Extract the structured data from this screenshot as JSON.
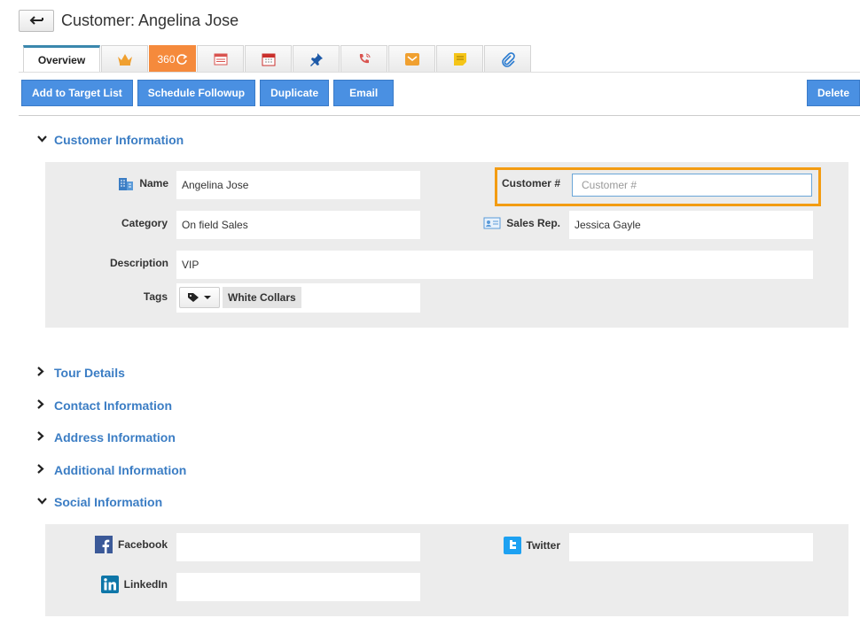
{
  "header": {
    "title": "Customer: Angelina Jose"
  },
  "tabs": {
    "overview": "Overview",
    "t360": "360"
  },
  "actions": {
    "add_to_target": "Add to Target List",
    "schedule_followup": "Schedule Followup",
    "duplicate": "Duplicate",
    "email": "Email",
    "delete": "Delete"
  },
  "sections": {
    "customer_info": "Customer Information",
    "tour_details": "Tour Details",
    "contact_info": "Contact Information",
    "address_info": "Address Information",
    "additional_info": "Additional Information",
    "social_info": "Social Information"
  },
  "customer": {
    "name_label": "Name",
    "name_value": "Angelina Jose",
    "customer_no_label": "Customer #",
    "customer_no_placeholder": "Customer #",
    "category_label": "Category",
    "category_value": "On field Sales",
    "sales_rep_label": "Sales Rep.",
    "sales_rep_value": "Jessica Gayle",
    "description_label": "Description",
    "description_value": "VIP",
    "tags_label": "Tags",
    "tag_value": "White Collars"
  },
  "social": {
    "facebook_label": "Facebook",
    "facebook_value": "",
    "twitter_label": "Twitter",
    "twitter_value": "",
    "linkedin_label": "LinkedIn",
    "linkedin_value": ""
  },
  "colors": {
    "accent": "#4a90e2",
    "section_title": "#3b7dc4",
    "highlight": "#f39c12",
    "tab360": "#f58a3c"
  }
}
